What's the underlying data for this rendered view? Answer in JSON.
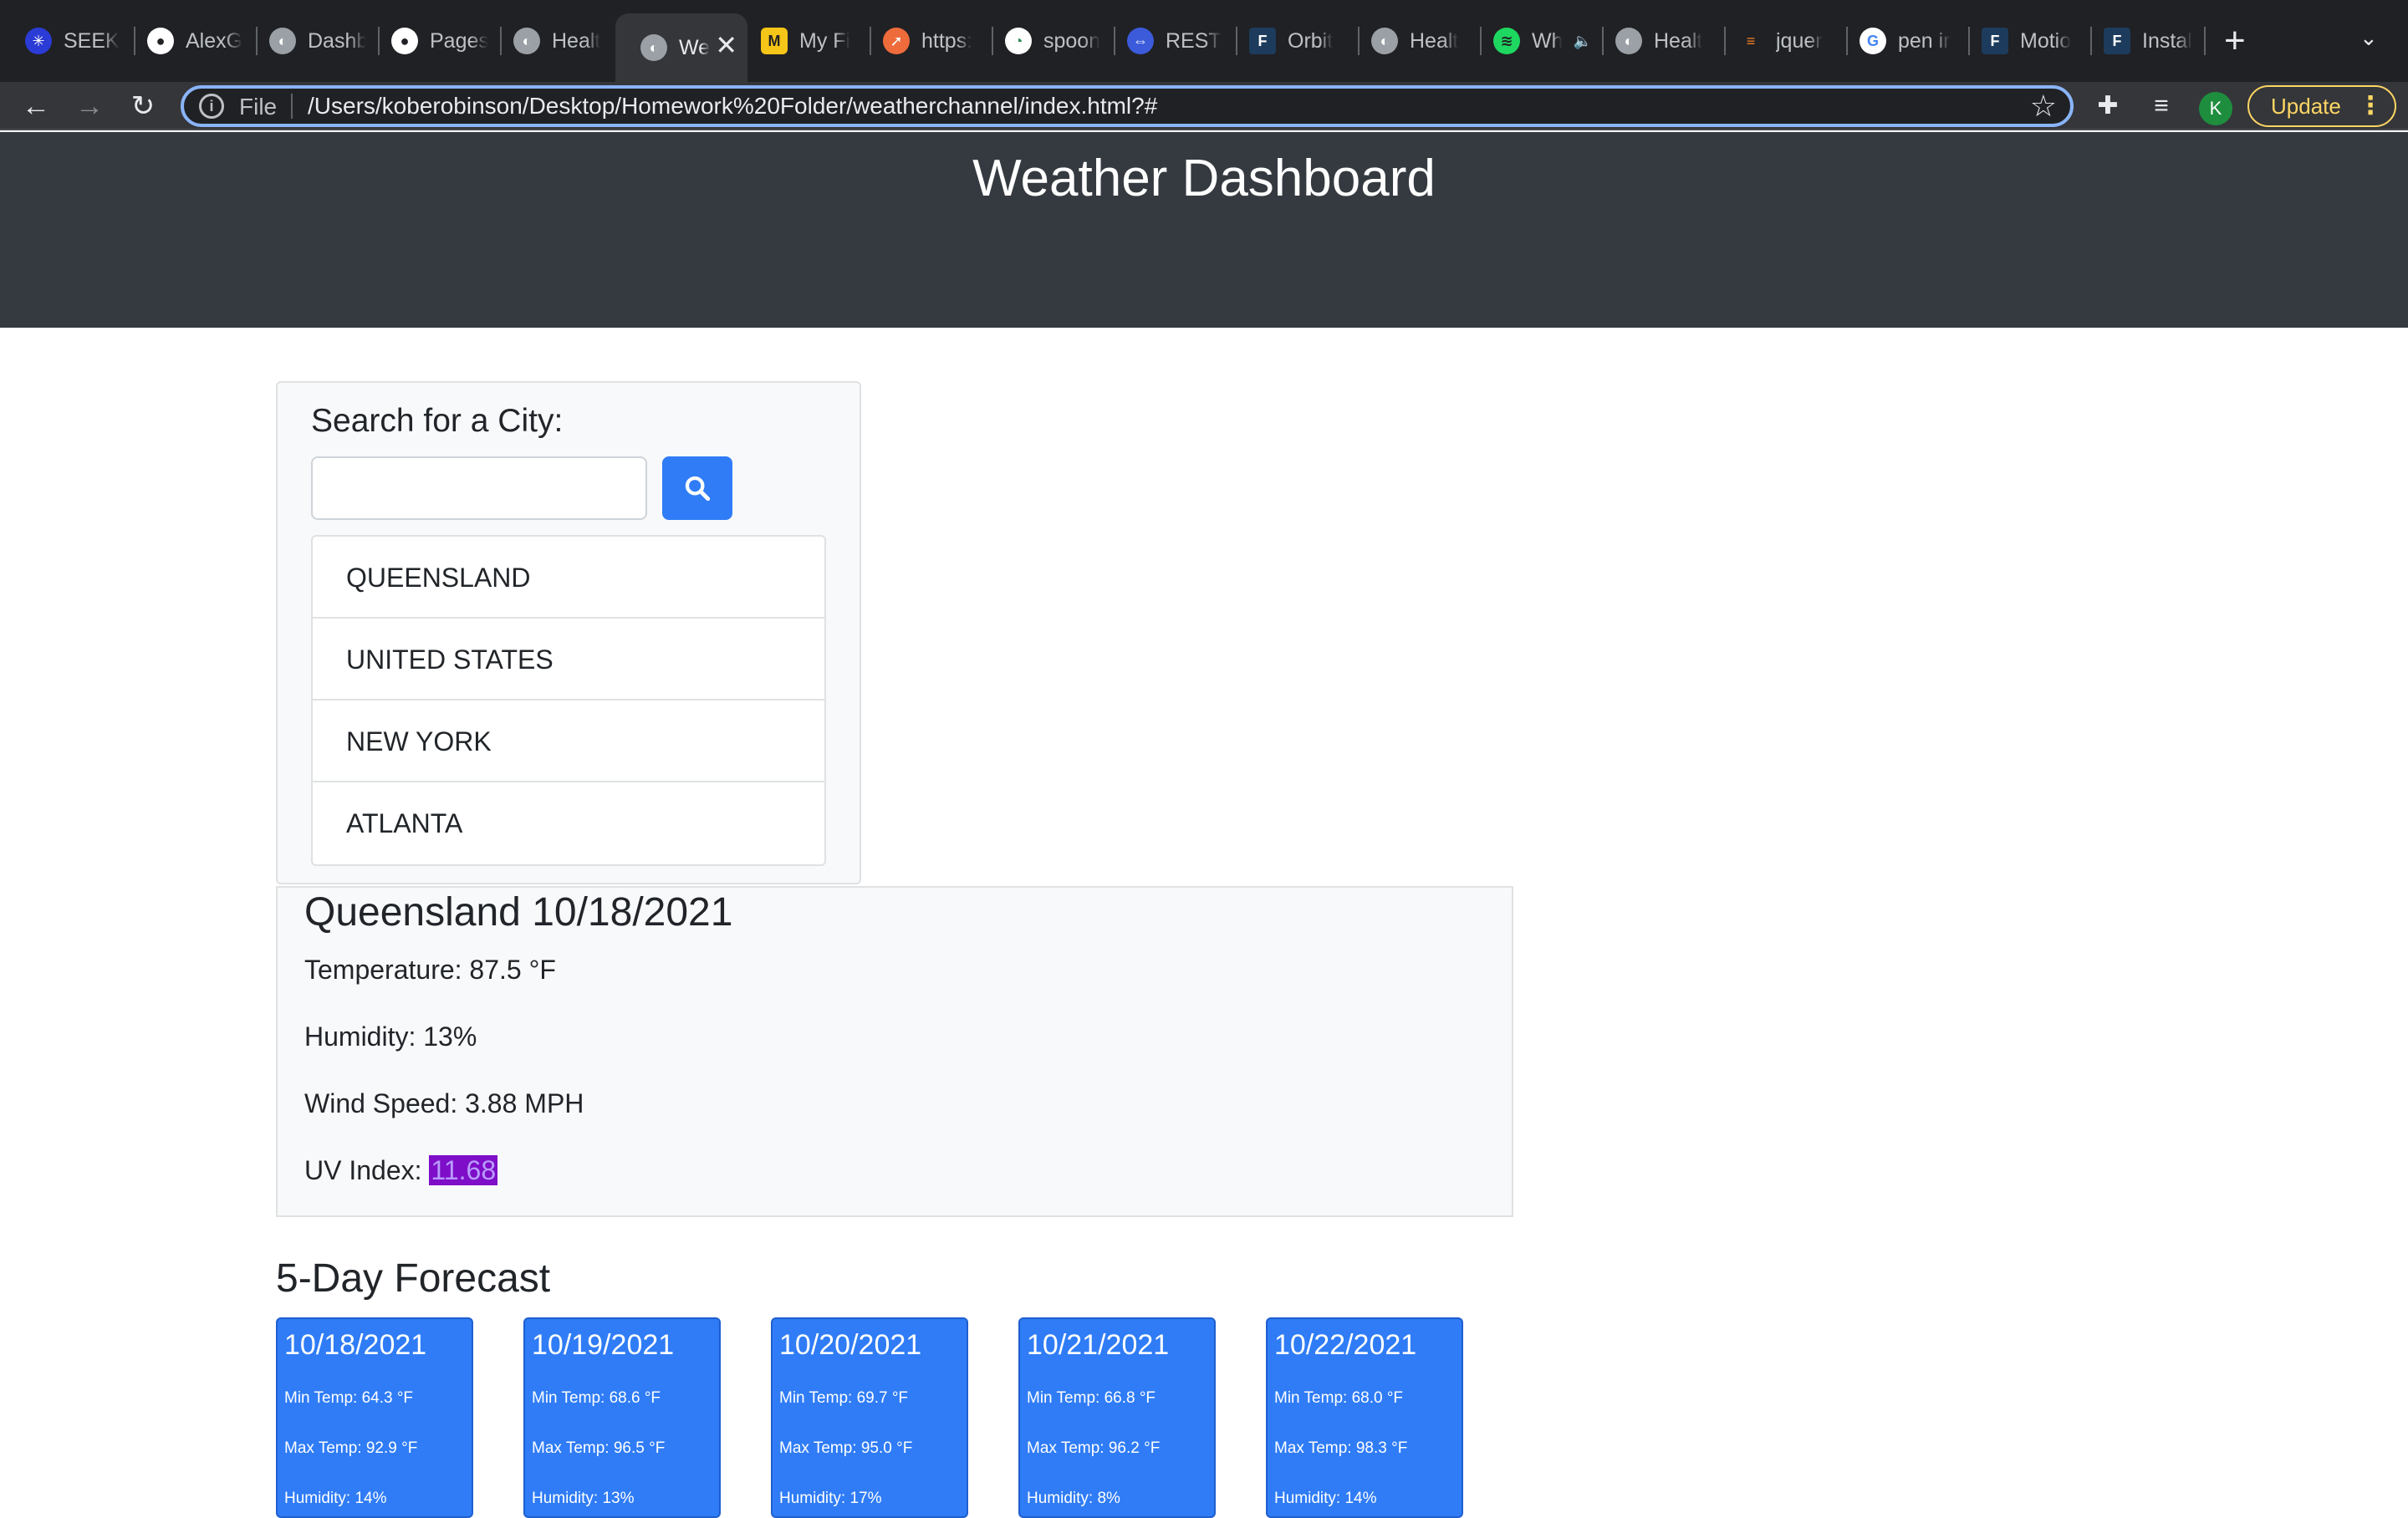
{
  "browser": {
    "tabs": [
      {
        "label": "SEEK",
        "fav_color": "#2b3bd6",
        "icon": "seek-icon"
      },
      {
        "label": "AlexG",
        "fav_color": "#202124",
        "icon": "github-icon"
      },
      {
        "label": "Dashb",
        "fav_color": "#5f6368",
        "icon": "globe-icon"
      },
      {
        "label": "Pages",
        "fav_color": "#202124",
        "icon": "github-icon"
      },
      {
        "label": "Healt",
        "fav_color": "#5f6368",
        "icon": "globe-icon"
      },
      {
        "label": "We",
        "fav_color": "#5f6368",
        "icon": "globe-icon"
      },
      {
        "label": "My Fi",
        "fav_color": "#f5c518",
        "icon": "miro-icon"
      },
      {
        "label": "https:",
        "fav_color": "#ee6b3b",
        "icon": "postman-icon"
      },
      {
        "label": "spoon",
        "fav_color": "#ffffff",
        "icon": "spoonacular-icon"
      },
      {
        "label": "REST",
        "fav_color": "#3b5bdb",
        "icon": "rest-icon"
      },
      {
        "label": "Orbit",
        "fav_color": "#1d3b5c",
        "icon": "f-icon"
      },
      {
        "label": "Healt",
        "fav_color": "#5f6368",
        "icon": "globe-icon"
      },
      {
        "label": "Wh",
        "fav_color": "#1ed760",
        "icon": "spotify-icon"
      },
      {
        "label": "Healt",
        "fav_color": "#5f6368",
        "icon": "globe-icon"
      },
      {
        "label": "jquer",
        "fav_color": "#f48024",
        "icon": "stackoverflow-icon"
      },
      {
        "label": "pen ir",
        "fav_color": "#ffffff",
        "icon": "google-icon"
      },
      {
        "label": "Motio",
        "fav_color": "#1d3b5c",
        "icon": "f-icon"
      },
      {
        "label": "Instal",
        "fav_color": "#1d3b5c",
        "icon": "f-icon"
      }
    ],
    "omnibox": {
      "scheme_label": "File",
      "url": "/Users/koberobinson/Desktop/Homework%20Folder/weatherchannel/index.html?#"
    },
    "profile_initial": "K",
    "update_label": "Update"
  },
  "page": {
    "title": "Weather Dashboard",
    "search": {
      "heading": "Search for a City:",
      "input_value": "",
      "history": [
        "QUEENSLAND",
        "UNITED STATES",
        "NEW YORK",
        "ATLANTA"
      ]
    },
    "current": {
      "title": "Queensland 10/18/2021",
      "temperature": "Temperature: 87.5 °F",
      "humidity": "Humidity: 13%",
      "wind": "Wind Speed: 3.88 MPH",
      "uv_label": "UV Index: ",
      "uv_value": "11.68",
      "uv_color": "#7e0ec8"
    },
    "forecast": {
      "heading": "5-Day Forecast",
      "days": [
        {
          "date": "10/18/2021",
          "min": "Min Temp: 64.3 °F",
          "max": "Max Temp: 92.9 °F",
          "humidity": "Humidity: 14%"
        },
        {
          "date": "10/19/2021",
          "min": "Min Temp: 68.6 °F",
          "max": "Max Temp: 96.5 °F",
          "humidity": "Humidity: 13%"
        },
        {
          "date": "10/20/2021",
          "min": "Min Temp: 69.7 °F",
          "max": "Max Temp: 95.0 °F",
          "humidity": "Humidity: 17%"
        },
        {
          "date": "10/21/2021",
          "min": "Min Temp: 66.8 °F",
          "max": "Max Temp: 96.2 °F",
          "humidity": "Humidity: 8%"
        },
        {
          "date": "10/22/2021",
          "min": "Min Temp: 68.0 °F",
          "max": "Max Temp: 98.3 °F",
          "humidity": "Humidity: 14%"
        }
      ]
    }
  },
  "colors": {
    "header_bg": "#343a40",
    "primary": "#2f7cf6",
    "card_bg": "#f8f9fa"
  }
}
